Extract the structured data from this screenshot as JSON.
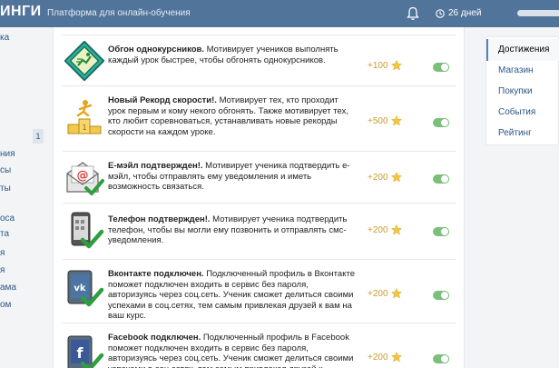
{
  "header": {
    "logo": "ИНГИ",
    "tagline": "Платформа для онлайн-обучения",
    "days_label": "26 дней"
  },
  "leftnav": {
    "items": [
      "ка",
      "ния",
      "сы",
      "ты",
      "оса",
      "та",
      "я",
      "я",
      "ама",
      "ом"
    ],
    "badge": "1"
  },
  "achievements": [
    {
      "title": "Обгон однокурсников.",
      "desc": " Мотивирует учеников выполнять каждый урок быстрее, чтобы обгонять однокурсников.",
      "points": "+100",
      "icon": "overtake-icon"
    },
    {
      "title": "Новый Рекорд скорости!.",
      "desc": " Мотивирует тех, кто проходит урок первым и кому некого обгонять. Также мотивирует тех, кто любит соревноваться, устанавливать новые рекорды скорости на каждом уроке.",
      "points": "+500",
      "icon": "podium-icon"
    },
    {
      "title": "E-мэйл подтвержден!.",
      "desc": " Мотивирует ученика подтвердить е-мэйл, чтобы отправлять ему уведомления и иметь возможность связаться.",
      "points": "+200",
      "icon": "email-check-icon"
    },
    {
      "title": "Телефон подтвержден!.",
      "desc": " Мотивирует ученика подтвердить телефон, чтобы вы могли ему позвонить и отправлять смс-уведомления.",
      "points": "+200",
      "icon": "phone-check-icon"
    },
    {
      "title": "Вконтакте подключен.",
      "desc": " Подключенный профиль в Вконтакте поможет подключен входить в сервис без пароля, авторизуясь через соц.сеть. Ученик сможет делиться своими успехами в соц.сетях, тем самым привлекая друзей к вам на ваш курс.",
      "points": "+200",
      "icon": "vk-check-icon"
    },
    {
      "title": "Facebook подключен.",
      "desc": " Подключенный профиль в Facebook поможет подключен входить в сервис без пароля, авторизуясь через соц.сеть. Ученик сможет делиться своими успехами в соц.сетях, тем самым привлекая друзей к",
      "points": "+200",
      "icon": "facebook-check-icon"
    }
  ],
  "rightnav": {
    "items": [
      "Достижения",
      "Магазин",
      "Покупки",
      "События",
      "Рейтинг"
    ]
  },
  "colors": {
    "topbar": "#51749a",
    "link": "#2a5885",
    "points": "#c99a2e",
    "toggle_on": "#7bbf7b"
  }
}
